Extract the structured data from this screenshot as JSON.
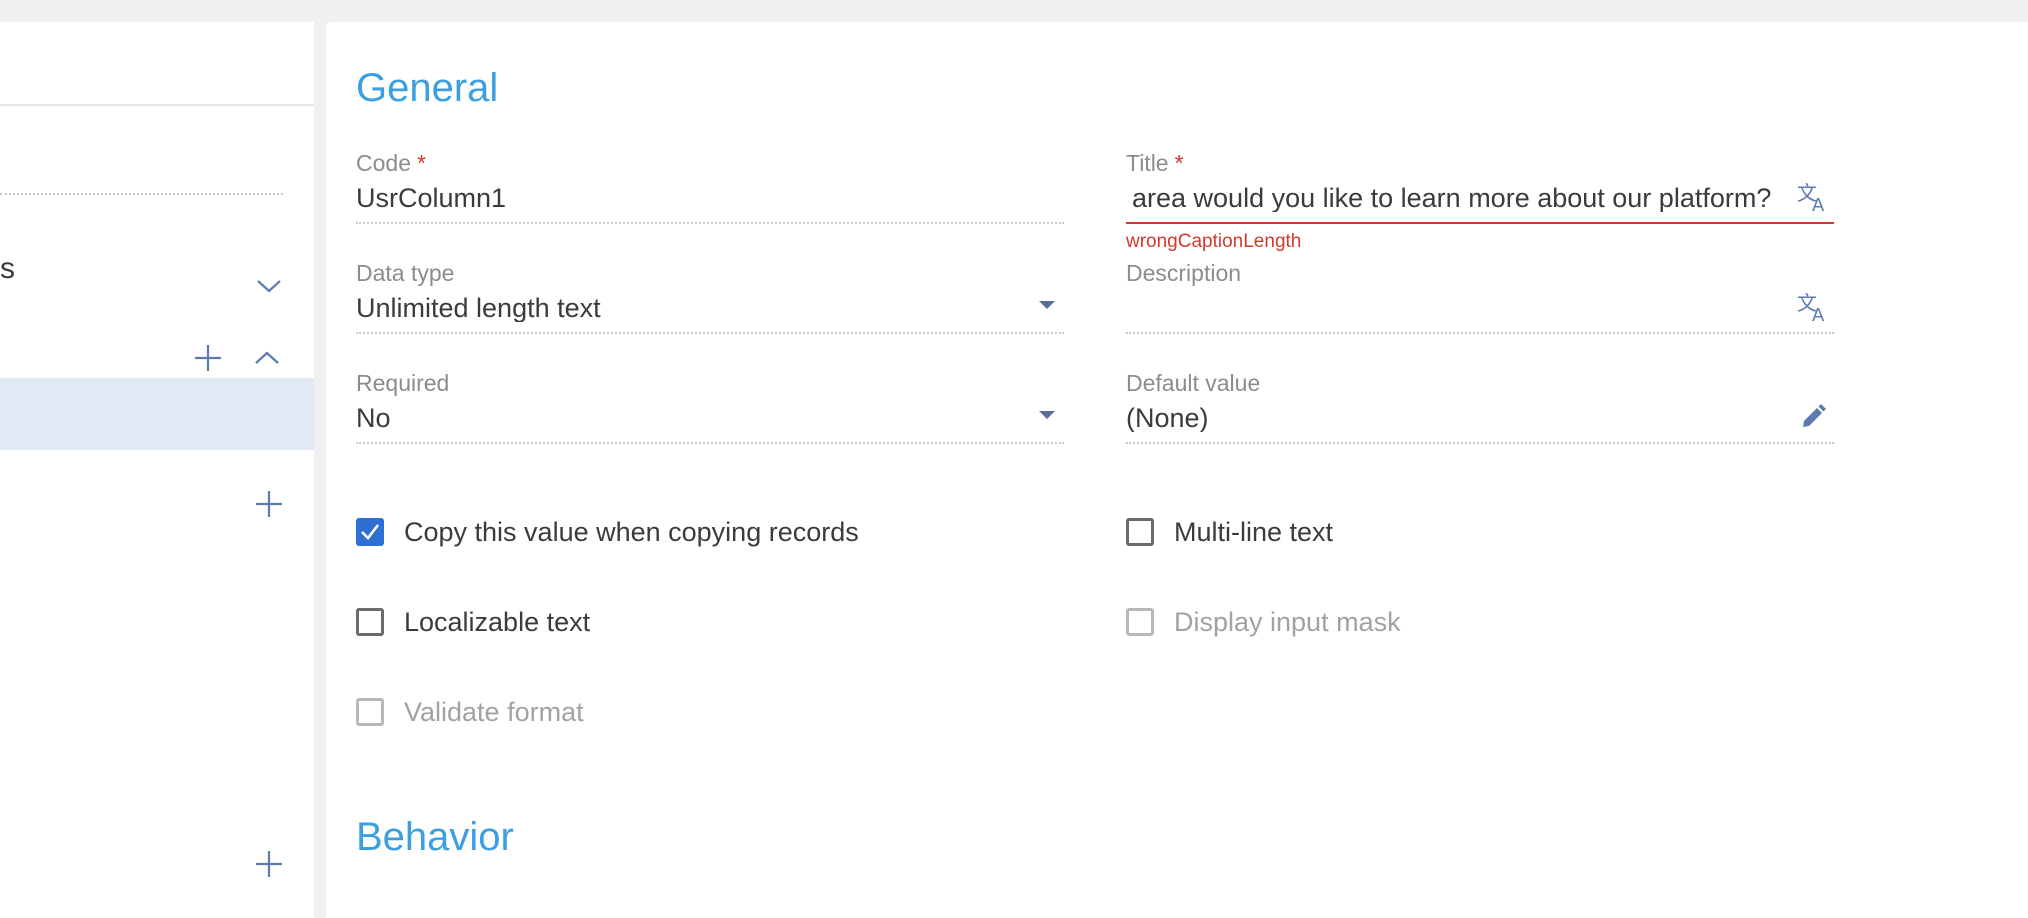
{
  "left_panel": {
    "partial_label": "s"
  },
  "sections": {
    "general_title": "General",
    "behavior_title": "Behavior"
  },
  "fields": {
    "code": {
      "label": "Code",
      "required_mark": "*",
      "value": "UsrColumn1"
    },
    "title": {
      "label": "Title",
      "required_mark": "*",
      "value": "area would you like to learn more about our platform?",
      "error": "wrongCaptionLength",
      "icon": "translate-icon"
    },
    "data_type": {
      "label": "Data type",
      "value": "Unlimited length text",
      "icon": "dropdown-arrow-icon"
    },
    "description": {
      "label": "Description",
      "value": "",
      "icon": "translate-icon"
    },
    "required": {
      "label": "Required",
      "value": "No",
      "icon": "dropdown-arrow-icon"
    },
    "default_value": {
      "label": "Default value",
      "value": "(None)",
      "icon": "pencil-icon"
    }
  },
  "checkboxes": {
    "copy_value": {
      "label": "Copy this value when copying records",
      "checked": true,
      "enabled": true
    },
    "multiline": {
      "label": "Multi-line text",
      "checked": false,
      "enabled": true
    },
    "localizable": {
      "label": "Localizable text",
      "checked": false,
      "enabled": true
    },
    "input_mask": {
      "label": "Display input mask",
      "checked": false,
      "enabled": false
    },
    "validate_format": {
      "label": "Validate format",
      "checked": false,
      "enabled": false
    }
  },
  "colors": {
    "accent": "#3b9fe2",
    "error": "#d0392b",
    "checkbox_checked": "#2d6fd2",
    "icon": "#5b7bb0",
    "selected_row": "#e1e9f5"
  }
}
